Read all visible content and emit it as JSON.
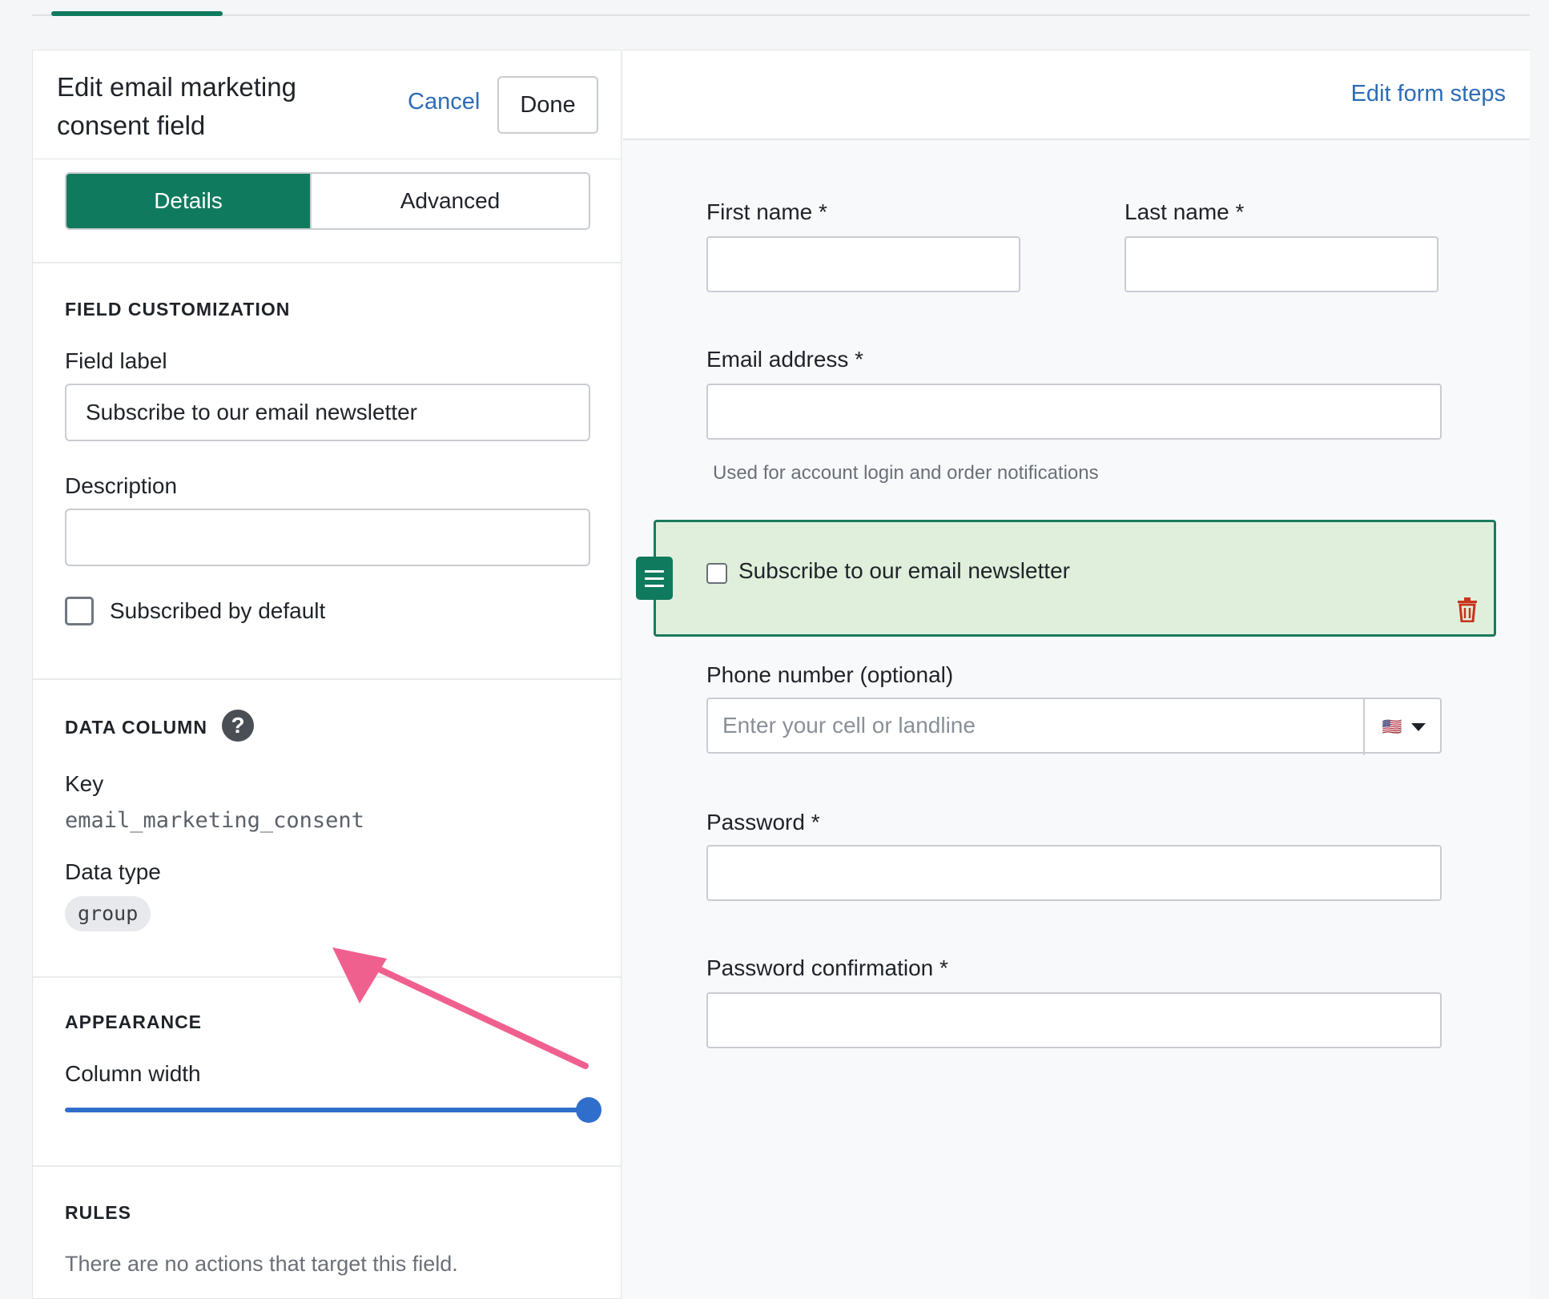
{
  "editor": {
    "title": "Edit email marketing consent field",
    "cancel_label": "Cancel",
    "done_label": "Done",
    "tabs": [
      {
        "label": "Details",
        "active": true
      },
      {
        "label": "Advanced",
        "active": false
      }
    ]
  },
  "field_customization": {
    "heading": "FIELD CUSTOMIZATION",
    "field_label_label": "Field label",
    "field_label_value": "Subscribe to our email newsletter",
    "description_label": "Description",
    "description_value": "",
    "subscribed_default_label": "Subscribed by default",
    "subscribed_default_checked": false
  },
  "data_column": {
    "heading": "DATA COLUMN",
    "help_icon": "question-circle-icon",
    "help_glyph": "?",
    "key_label": "Key",
    "key_value": "email_marketing_consent",
    "data_type_label": "Data type",
    "data_type_value": "group"
  },
  "appearance": {
    "heading": "APPEARANCE",
    "column_width_label": "Column width",
    "column_width_fraction": 1.0
  },
  "rules": {
    "heading": "RULES",
    "empty_text": "There are no actions that target this field."
  },
  "preview": {
    "edit_steps_label": "Edit form steps",
    "first_name_label": "First name *",
    "last_name_label": "Last name *",
    "email_label": "Email address *",
    "email_hint": "Used for account login and order notifications",
    "consent_label": "Subscribe to our email newsletter",
    "phone_label": "Phone number (optional)",
    "phone_placeholder": "Enter your cell or landline",
    "phone_country_flag": "🇺🇸",
    "password_label": "Password *",
    "password_confirm_label": "Password confirmation *"
  },
  "colors": {
    "accent": "#107a5e",
    "link": "#2d6cb5",
    "selected_block_bg": "#e0efdc",
    "slider": "#2f6fcb",
    "annotation_arrow": "#f0608f",
    "trash": "#c8331e"
  }
}
